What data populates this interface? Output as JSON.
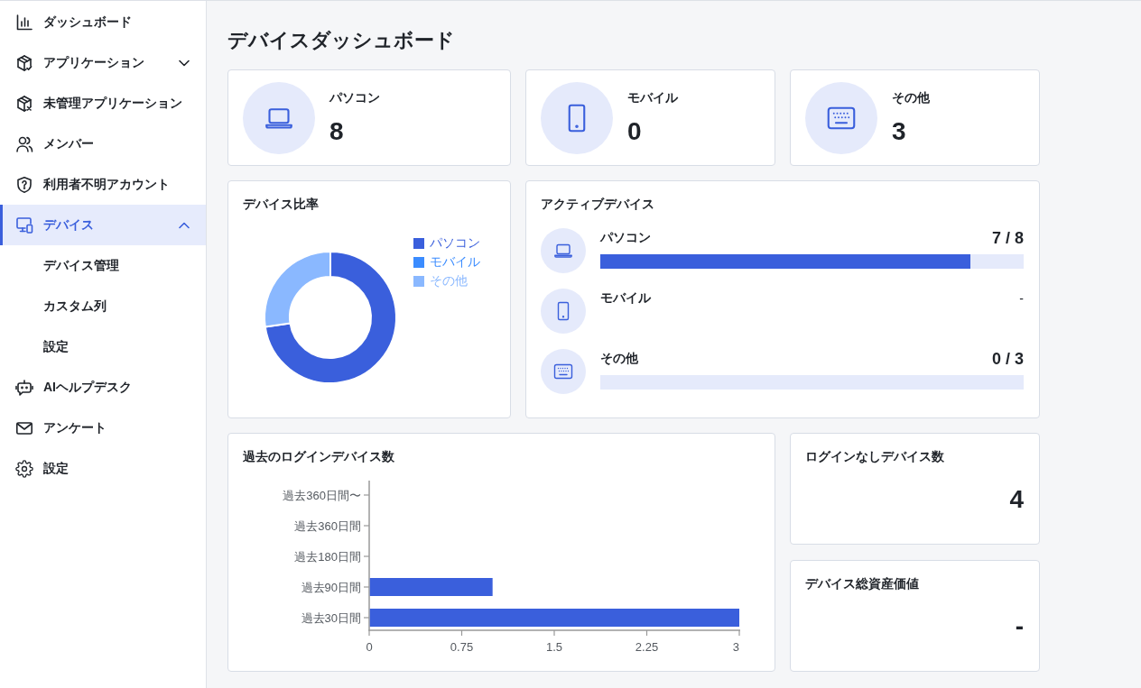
{
  "sidebar": {
    "items": [
      {
        "label": "ダッシュボード",
        "selected": false
      },
      {
        "label": "アプリケーション",
        "selected": false,
        "expanded": false
      },
      {
        "label": "未管理アプリケーション",
        "selected": false
      },
      {
        "label": "メンバー",
        "selected": false
      },
      {
        "label": "利用者不明アカウント",
        "selected": false
      },
      {
        "label": "デバイス",
        "selected": true,
        "expanded": true,
        "children": [
          {
            "label": "デバイス管理",
            "selected": false
          },
          {
            "label": "カスタム列",
            "selected": false
          },
          {
            "label": "設定",
            "selected": false
          }
        ]
      },
      {
        "label": "AIヘルプデスク",
        "selected": false
      },
      {
        "label": "アンケート",
        "selected": false
      },
      {
        "label": "設定",
        "selected": false
      }
    ]
  },
  "page": {
    "title": "デバイスダッシュボード"
  },
  "summary_cards": [
    {
      "label": "パソコン",
      "value": "8"
    },
    {
      "label": "モバイル",
      "value": "0"
    },
    {
      "label": "その他",
      "value": "3"
    }
  ],
  "device_ratio": {
    "chart_data": {
      "type": "donut",
      "title": "デバイス比率",
      "categories": [
        "パソコン",
        "モバイル",
        "その他"
      ],
      "values": [
        72.7,
        0,
        27.3
      ],
      "colors": [
        "#3a5fdc",
        "#3b8cff",
        "#8ab8ff"
      ],
      "legend": "right"
    }
  },
  "active_devices": {
    "title": "アクティブデバイス",
    "items": [
      {
        "kind": "meter",
        "name": "パソコン",
        "reading": "7 / 8",
        "level": 0.875
      },
      {
        "kind": "empty",
        "name": "モバイル",
        "reading": "-"
      },
      {
        "kind": "meter",
        "name": "その他",
        "reading": "0 / 3",
        "level": 0
      }
    ]
  },
  "login_history": {
    "chart_data": {
      "type": "bar",
      "orientation": "horizontal",
      "title": "過去のログインデバイス数",
      "categories": [
        "過去360日間〜",
        "過去360日間",
        "過去180日間",
        "過去90日間",
        "過去30日間"
      ],
      "values": [
        0,
        0,
        0,
        1,
        3
      ],
      "xlim": [
        0,
        3
      ],
      "xticks": [
        0,
        0.75,
        1.5,
        2.25,
        3
      ]
    }
  },
  "stats": [
    {
      "title": "ログインなしデバイス数",
      "value": "4"
    },
    {
      "title": "デバイス総資産価値",
      "value": "-"
    }
  ]
}
